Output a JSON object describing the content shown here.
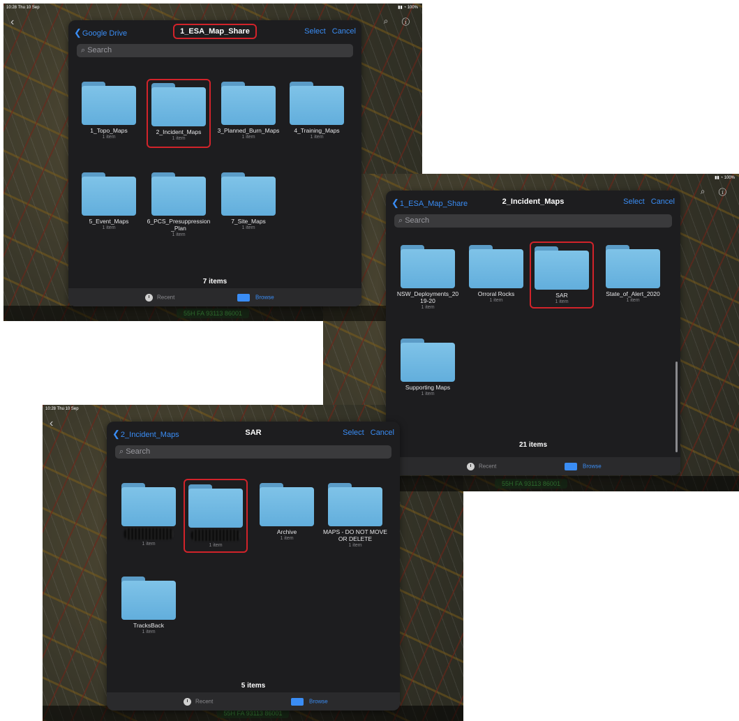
{
  "status": {
    "time": "10:28  Thu 10 Sep",
    "battery": "100%"
  },
  "map": {
    "coordinates": "55H FA 93113 86001"
  },
  "tabbar": {
    "recent": "Recent",
    "browse": "Browse"
  },
  "nav_actions": {
    "select": "Select",
    "cancel": "Cancel"
  },
  "search_placeholder": "Search",
  "shot1": {
    "back": "Google Drive",
    "title": "1_ESA_Map_Share",
    "count": "7 items",
    "folders": [
      {
        "name": "1_Topo_Maps",
        "count": "1 item"
      },
      {
        "name": "2_Incident_Maps",
        "count": "1 item"
      },
      {
        "name": "3_Planned_Burn_Maps",
        "count": "1 item"
      },
      {
        "name": "4_Training_Maps",
        "count": "1 item"
      },
      {
        "name": "5_Event_Maps",
        "count": "1 item"
      },
      {
        "name": "6_PCS_Presuppression_Plan",
        "count": "1 item"
      },
      {
        "name": "7_Site_Maps",
        "count": "1 item"
      }
    ]
  },
  "shot2": {
    "back": "1_ESA_Map_Share",
    "title": "2_Incident_Maps",
    "count": "21 items",
    "folders": [
      {
        "name": "NSW_Deployments_2019-20",
        "count": "1 item"
      },
      {
        "name": "Orroral Rocks",
        "count": "1 item"
      },
      {
        "name": "SAR",
        "count": "1 item"
      },
      {
        "name": "State_of_Alert_2020",
        "count": "1 item"
      },
      {
        "name": "Supporting Maps",
        "count": "1 item"
      }
    ]
  },
  "shot3": {
    "back": "2_Incident_Maps",
    "title": "SAR",
    "count": "5 items",
    "folders": [
      {
        "name": "",
        "count": "1 item"
      },
      {
        "name": "",
        "count": "1 item"
      },
      {
        "name": "Archive",
        "count": "1 item"
      },
      {
        "name": "MAPS - DO NOT MOVE OR DELETE",
        "count": "1 item"
      },
      {
        "name": "TracksBack",
        "count": "1 item"
      }
    ]
  }
}
